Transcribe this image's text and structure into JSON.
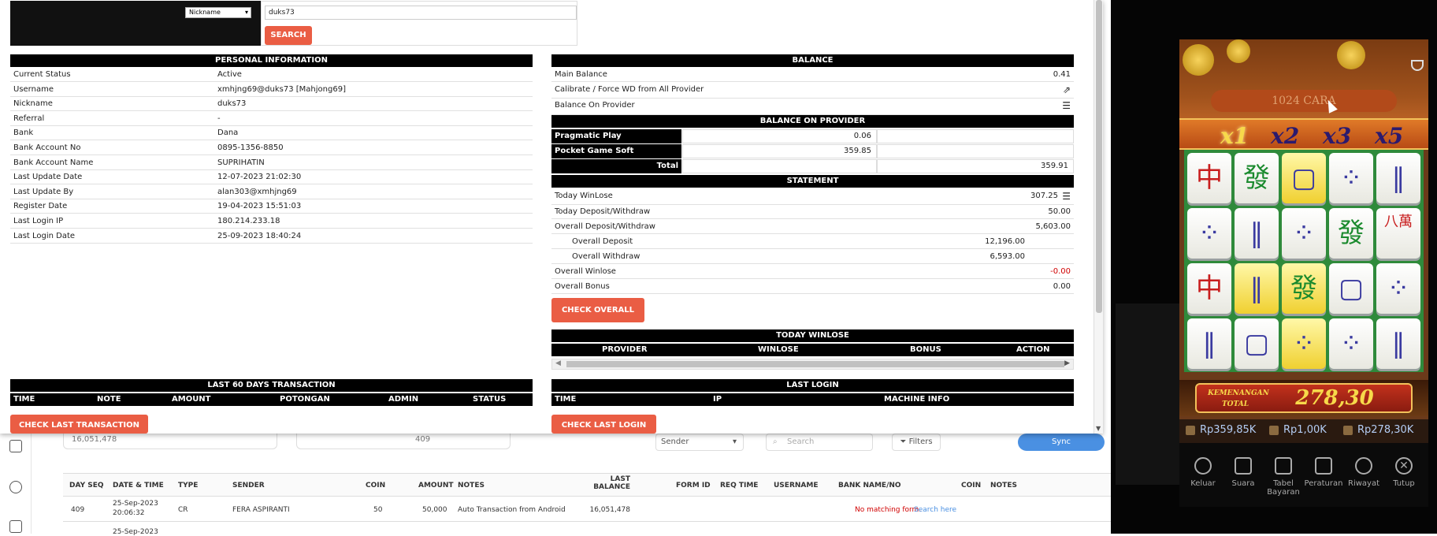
{
  "search": {
    "select_value": "Nickname",
    "query": "duks73",
    "button": "SEARCH"
  },
  "personal": {
    "header": "PERSONAL INFORMATION",
    "rows": [
      {
        "k": "Current Status",
        "v": "Active"
      },
      {
        "k": "Username",
        "v": "xmhjng69@duks73  [Mahjong69]"
      },
      {
        "k": "Nickname",
        "v": "duks73"
      },
      {
        "k": "Referral",
        "v": "-"
      },
      {
        "k": "Bank",
        "v": "Dana"
      },
      {
        "k": "Bank Account No",
        "v": "0895-1356-8850"
      },
      {
        "k": "Bank Account Name",
        "v": "SUPRIHATIN"
      },
      {
        "k": "Last Update Date",
        "v": "12-07-2023 21:02:30"
      },
      {
        "k": "Last Update By",
        "v": "alan303@xmhjng69"
      },
      {
        "k": "Register Date",
        "v": "19-04-2023 15:51:03"
      },
      {
        "k": "Last Login IP",
        "v": "180.214.233.18"
      },
      {
        "k": "Last Login Date",
        "v": "25-09-2023 18:40:24"
      }
    ]
  },
  "balance": {
    "header": "BALANCE",
    "main_label": "Main Balance",
    "main_value": "0.41",
    "calibrate_label": "Calibrate / Force WD from All Provider",
    "on_provider_label": "Balance On Provider",
    "provider_header": "BALANCE ON PROVIDER",
    "providers": [
      {
        "name": "Pragmatic Play",
        "value": "0.06"
      },
      {
        "name": "Pocket Game Soft",
        "value": "359.85"
      }
    ],
    "total_label": "Total",
    "total_value": "359.91"
  },
  "statement": {
    "header": "STATEMENT",
    "today_winlose_label": "Today WinLose",
    "today_winlose": "307.25",
    "today_dw_label": "Today Deposit/Withdraw",
    "today_dw": "50.00",
    "overall_dw_label": "Overall Deposit/Withdraw",
    "overall_dw": "5,603.00",
    "overall_deposit_label": "Overall Deposit",
    "overall_deposit": "12,196.00",
    "overall_withdraw_label": "Overall Withdraw",
    "overall_withdraw": "6,593.00",
    "overall_winlose_label": "Overall Winlose",
    "overall_winlose": "-0.00",
    "overall_bonus_label": "Overall Bonus",
    "overall_bonus": "0.00",
    "check_overall": "CHECK OVERALL"
  },
  "today_winlose": {
    "header": "TODAY WINLOSE",
    "cols": [
      "PROVIDER",
      "WINLOSE",
      "BONUS",
      "ACTION"
    ]
  },
  "last60": {
    "header": "LAST 60 DAYS TRANSACTION",
    "cols": [
      "TIME",
      "NOTE",
      "AMOUNT",
      "POTONGAN",
      "ADMIN",
      "STATUS"
    ],
    "button": "CHECK LAST TRANSACTION"
  },
  "lastlogin": {
    "header": "LAST LOGIN",
    "cols": [
      "TIME",
      "IP",
      "MACHINE INFO"
    ],
    "button": "CHECK LAST LOGIN"
  },
  "bgapp": {
    "box1": "16,051,478",
    "box2": "409",
    "sender": "Sender",
    "search_placeholder": "Search",
    "filters": "Filters",
    "sync": "Sync",
    "cols": [
      "DAY SEQ",
      "DATE & TIME",
      "TYPE",
      "SENDER",
      "COIN",
      "AMOUNT",
      "NOTES",
      "LAST BALANCE",
      "FORM ID",
      "REQ TIME",
      "USERNAME",
      "BANK NAME/NO",
      "COIN",
      "NOTES"
    ],
    "row": {
      "seq": "409",
      "date": "25-Sep-2023",
      "time": "20:06:32",
      "type": "CR",
      "sender": "FERA ASPIRANTI",
      "coin": "50",
      "amount": "50,000",
      "notes": "Auto Transaction from Android",
      "balance": "16,051,478",
      "nomatch": "No matching form.",
      "search_here": "Search here"
    },
    "row2_date": "25-Sep-2023"
  },
  "game": {
    "ways": "1024 CARA",
    "multipliers": [
      "x1",
      "x2",
      "x3",
      "x5"
    ],
    "win_label_1": "KEMENANGAN",
    "win_label_2": "TOTAL",
    "win_value": "278,30",
    "balance": "Rp359,85K",
    "bet": "Rp1,00K",
    "win": "Rp278,30K",
    "menu": [
      "Keluar",
      "Suara",
      "Tabel Bayaran",
      "Peraturan",
      "Riwayat",
      "Tutup"
    ],
    "tiles": [
      [
        "中",
        "發",
        "▢",
        "⁘",
        "‖"
      ],
      [
        "⁘",
        "‖",
        "⁘",
        "發",
        "八萬"
      ],
      [
        "中",
        "‖",
        "發",
        "▢",
        "⁘"
      ],
      [
        "‖",
        "▢",
        "⁘",
        "⁘",
        "‖"
      ]
    ]
  },
  "colors": {
    "accent": "#ea5d44",
    "header_bg": "#000000",
    "sync": "#4a90e2",
    "negative": "#d00000"
  }
}
